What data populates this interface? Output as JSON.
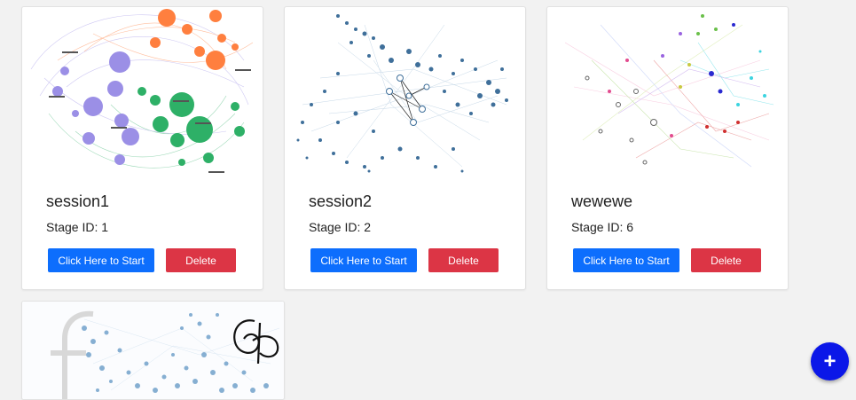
{
  "sessions": [
    {
      "name": "session1",
      "stage_label": "Stage ID:",
      "stage_id": "1",
      "start_label": "Click Here to Start",
      "delete_label": "Delete"
    },
    {
      "name": "session2",
      "stage_label": "Stage ID:",
      "stage_id": "2",
      "start_label": "Click Here to Start",
      "delete_label": "Delete"
    },
    {
      "name": "wewewe",
      "stage_label": "Stage ID:",
      "stage_id": "6",
      "start_label": "Click Here to Start",
      "delete_label": "Delete"
    }
  ],
  "fab": {
    "icon": "plus-icon",
    "symbol": "+"
  },
  "colors": {
    "primary": "#0d6efd",
    "danger": "#dc3545",
    "fab": "#0b17e8"
  }
}
